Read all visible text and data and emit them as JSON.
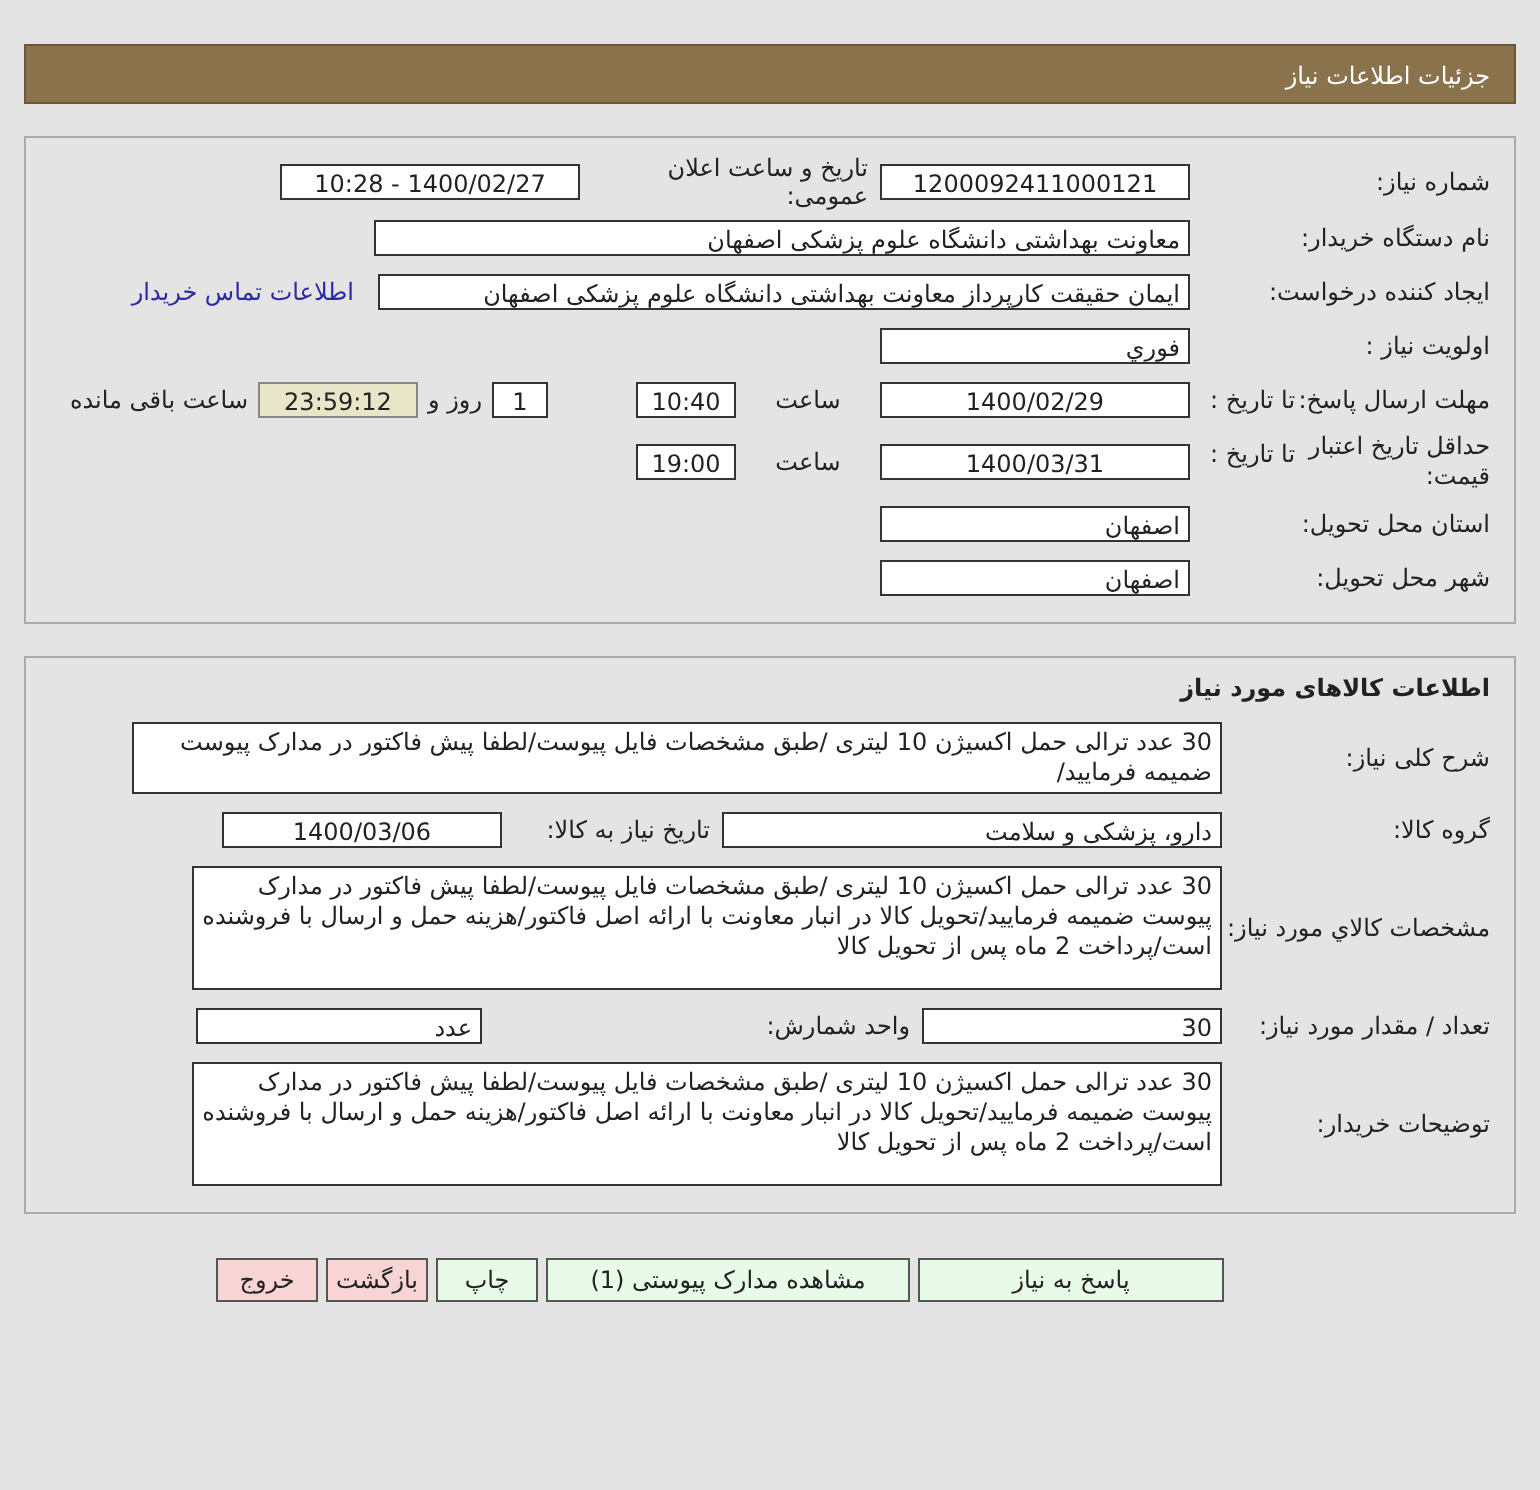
{
  "header": {
    "title": "جزئیات اطلاعات نیاز"
  },
  "general": {
    "need_number": {
      "label": "شماره نیاز:",
      "value": "1200092411000121"
    },
    "announce": {
      "label": "تاریخ و ساعت اعلان عمومی:",
      "value": "1400/02/27 - 10:28"
    },
    "buyer": {
      "label": "نام دستگاه خریدار:",
      "value": "معاونت بهداشتی دانشگاه علوم پزشکی اصفهان"
    },
    "creator": {
      "label": "ایجاد کننده درخواست:",
      "value": "ایمان حقیقت کارپرداز معاونت بهداشتی دانشگاه علوم پزشکی اصفهان",
      "link": "اطلاعات تماس خریدار"
    },
    "priority": {
      "label": "اولویت نیاز :",
      "value": "فوري"
    },
    "deadline": {
      "label": "مهلت ارسال پاسخ:",
      "sublabel": "تا تاریخ :",
      "date": "1400/02/29",
      "time_label": "ساعت",
      "time": "10:40",
      "days": "1",
      "days_label": "روز و",
      "remaining": "23:59:12",
      "remaining_label": "ساعت باقی مانده"
    },
    "validity": {
      "label": "حداقل تاریخ اعتبار قیمت:",
      "sublabel": "تا تاریخ :",
      "date": "1400/03/31",
      "time_label": "ساعت",
      "time": "19:00"
    },
    "province": {
      "label": "استان محل تحویل:",
      "value": "اصفهان"
    },
    "city": {
      "label": "شهر محل تحویل:",
      "value": "اصفهان"
    }
  },
  "goods": {
    "title": "اطلاعات کالاهای مورد نیاز",
    "summary": {
      "label": "شرح کلی نیاز:",
      "value": "30 عدد ترالی حمل اکسیژن 10 لیتری /طبق مشخصات فایل پیوست/لطفا پیش فاکتور در مدارک پیوست ضمیمه فرمایید/"
    },
    "group": {
      "label": "گروه کالا:",
      "value": "دارو، پزشکی و سلامت",
      "date_label": "تاریخ نیاز به کالا:",
      "date": "1400/03/06"
    },
    "specs": {
      "label": "مشخصات کالاي مورد نیاز:",
      "value": "30 عدد ترالی حمل اکسیژن 10 لیتری /طبق مشخصات فایل پیوست/لطفا پیش فاکتور در مدارک پیوست ضمیمه فرمایید/تحویل کالا در انبار معاونت با ارائه اصل فاکتور/هزینه حمل و ارسال با فروشنده است/پرداخت 2 ماه پس از تحویل کالا"
    },
    "quantity": {
      "label": "تعداد / مقدار مورد نیاز:",
      "value": "30",
      "unit_label": "واحد شمارش:",
      "unit": "عدد"
    },
    "notes": {
      "label": "توضیحات خریدار:",
      "value": "30 عدد ترالی حمل اکسیژن 10 لیتری /طبق مشخصات فایل پیوست/لطفا پیش فاکتور در مدارک پیوست ضمیمه فرمایید/تحویل کالا در انبار معاونت با ارائه اصل فاکتور/هزینه حمل و ارسال با فروشنده است/پرداخت 2 ماه پس از تحویل کالا"
    }
  },
  "buttons": [
    {
      "label": "پاسخ به نیاز",
      "kind": "primary"
    },
    {
      "label": "مشاهده مدارک پیوستی (1)",
      "kind": "primary"
    },
    {
      "label": "چاپ",
      "kind": "primary"
    },
    {
      "label": "بازگشت",
      "kind": "danger"
    },
    {
      "label": "خروج",
      "kind": "danger"
    }
  ]
}
